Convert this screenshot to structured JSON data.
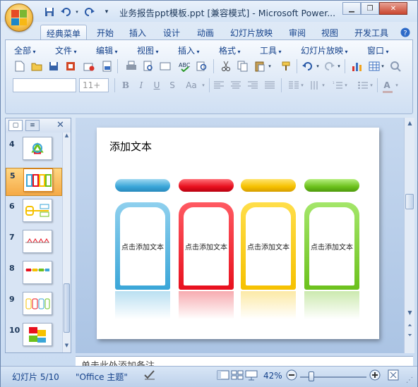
{
  "window": {
    "title": "业务报告ppt模板.ppt [兼容模式] - Microsoft Power...",
    "controls": [
      "minimize-icon",
      "restore-icon",
      "close-icon"
    ]
  },
  "quick_access": [
    "save-icon",
    "undo-icon",
    "redo-icon",
    "customize-icon"
  ],
  "tabs": [
    {
      "label": "经典菜单",
      "active": true
    },
    {
      "label": "开始"
    },
    {
      "label": "插入"
    },
    {
      "label": "设计"
    },
    {
      "label": "动画"
    },
    {
      "label": "幻灯片放映"
    },
    {
      "label": "审阅"
    },
    {
      "label": "视图"
    },
    {
      "label": "开发工具"
    }
  ],
  "menu": [
    "全部",
    "文件",
    "编辑",
    "视图",
    "插入",
    "格式",
    "工具",
    "幻灯片放映",
    "窗口"
  ],
  "font_combo": {
    "font": "",
    "size": "11+"
  },
  "slides": [
    {
      "num": "4"
    },
    {
      "num": "5",
      "selected": true
    },
    {
      "num": "6"
    },
    {
      "num": "7"
    },
    {
      "num": "8"
    },
    {
      "num": "9"
    },
    {
      "num": "10"
    }
  ],
  "slide": {
    "title": "添加文本",
    "columns": [
      {
        "text": "点击添加文本",
        "color": "#3aa6d8"
      },
      {
        "text": "点击添加文本",
        "color": "#e8101e"
      },
      {
        "text": "点击添加文本",
        "color": "#f6c100"
      },
      {
        "text": "点击添加文本",
        "color": "#6cc11c"
      }
    ]
  },
  "notes_placeholder": "单击此处添加备注",
  "status": {
    "slide_info": "幻灯片 5/10",
    "theme": "\"Office 主题\"",
    "zoom": "42%"
  }
}
